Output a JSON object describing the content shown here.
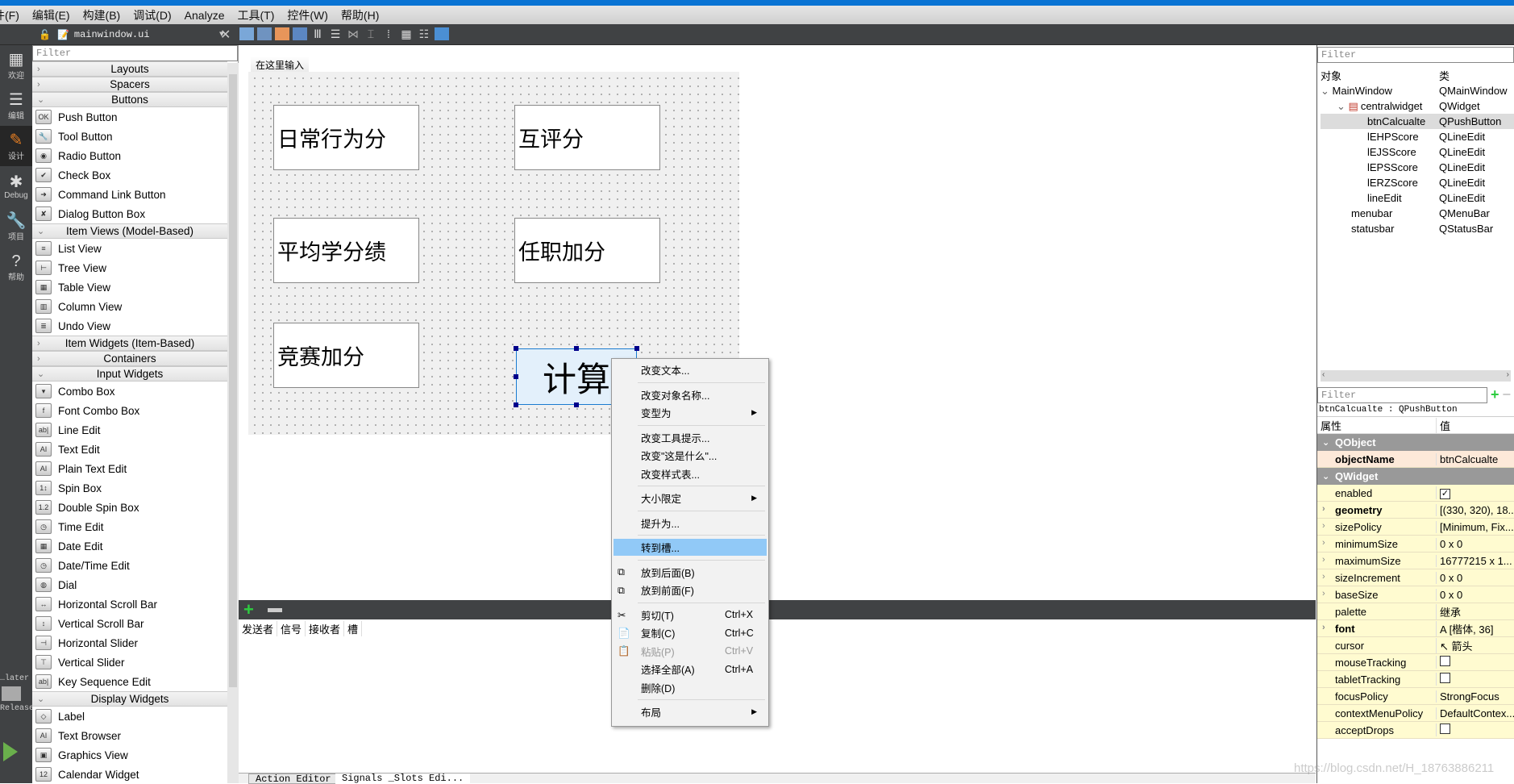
{
  "menubar": [
    "文件(F)",
    "编辑(E)",
    "构建(B)",
    "调试(D)",
    "Analyze",
    "工具(T)",
    "控件(W)",
    "帮助(H)"
  ],
  "toolbar": {
    "file_name": "mainwindow.ui"
  },
  "modebar": [
    {
      "label": "欢迎",
      "icon": "grid-icon"
    },
    {
      "label": "编辑",
      "icon": "edit-icon"
    },
    {
      "label": "设计",
      "icon": "pencil-icon",
      "active": true
    },
    {
      "label": "Debug",
      "icon": "bug-icon"
    },
    {
      "label": "项目",
      "icon": "wrench-icon"
    },
    {
      "label": "帮助",
      "icon": "help-icon"
    }
  ],
  "modebar_bottom": {
    "kit_label": "…later",
    "build_label": "Release"
  },
  "widgetbox": {
    "filter_placeholder": "Filter",
    "sections": [
      {
        "name": "Layouts",
        "expanded": false,
        "items": []
      },
      {
        "name": "Spacers",
        "expanded": false,
        "items": []
      },
      {
        "name": "Buttons",
        "expanded": true,
        "items": [
          {
            "label": "Push Button",
            "glyph": "OK"
          },
          {
            "label": "Tool Button",
            "glyph": "🔧"
          },
          {
            "label": "Radio Button",
            "glyph": "◉"
          },
          {
            "label": "Check Box",
            "glyph": "✔"
          },
          {
            "label": "Command Link Button",
            "glyph": "➜"
          },
          {
            "label": "Dialog Button Box",
            "glyph": "✘"
          }
        ]
      },
      {
        "name": "Item Views (Model-Based)",
        "expanded": true,
        "items": [
          {
            "label": "List View",
            "glyph": "≡"
          },
          {
            "label": "Tree View",
            "glyph": "⊢"
          },
          {
            "label": "Table View",
            "glyph": "▦"
          },
          {
            "label": "Column View",
            "glyph": "▥"
          },
          {
            "label": "Undo View",
            "glyph": "≣"
          }
        ]
      },
      {
        "name": "Item Widgets (Item-Based)",
        "expanded": false,
        "items": []
      },
      {
        "name": "Containers",
        "expanded": false,
        "items": []
      },
      {
        "name": "Input Widgets",
        "expanded": true,
        "items": [
          {
            "label": "Combo Box",
            "glyph": "▾"
          },
          {
            "label": "Font Combo Box",
            "glyph": "f"
          },
          {
            "label": "Line Edit",
            "glyph": "ab|"
          },
          {
            "label": "Text Edit",
            "glyph": "AI"
          },
          {
            "label": "Plain Text Edit",
            "glyph": "AI"
          },
          {
            "label": "Spin Box",
            "glyph": "1↕"
          },
          {
            "label": "Double Spin Box",
            "glyph": "1.2"
          },
          {
            "label": "Time Edit",
            "glyph": "◷"
          },
          {
            "label": "Date Edit",
            "glyph": "▦"
          },
          {
            "label": "Date/Time Edit",
            "glyph": "◷"
          },
          {
            "label": "Dial",
            "glyph": "◍"
          },
          {
            "label": "Horizontal Scroll Bar",
            "glyph": "↔"
          },
          {
            "label": "Vertical Scroll Bar",
            "glyph": "↕"
          },
          {
            "label": "Horizontal Slider",
            "glyph": "⊣"
          },
          {
            "label": "Vertical Slider",
            "glyph": "⊤"
          },
          {
            "label": "Key Sequence Edit",
            "glyph": "ab|"
          }
        ]
      },
      {
        "name": "Display Widgets",
        "expanded": true,
        "items": [
          {
            "label": "Label",
            "glyph": "◇"
          },
          {
            "label": "Text Browser",
            "glyph": "AI"
          },
          {
            "label": "Graphics View",
            "glyph": "▣"
          },
          {
            "label": "Calendar Widget",
            "glyph": "12"
          }
        ]
      }
    ]
  },
  "form": {
    "menu_placeholder": "在这里输入",
    "line_edits": [
      "日常行为分",
      "互评分",
      "平均学分绩",
      "任职加分",
      "竞赛加分"
    ],
    "button_text": "计算"
  },
  "signal_editor": {
    "columns": [
      "发送者",
      "信号",
      "接收者",
      "槽"
    ],
    "tabs": [
      "Action Editor",
      "Signals _Slots Edi..."
    ]
  },
  "context_menu": {
    "items": [
      {
        "label": "改变文本..."
      },
      {
        "sep": true
      },
      {
        "label": "改变对象名称..."
      },
      {
        "label": "变型为",
        "submenu": true
      },
      {
        "sep": true
      },
      {
        "label": "改变工具提示..."
      },
      {
        "label": "改变\"这是什么\"..."
      },
      {
        "label": "改变样式表..."
      },
      {
        "sep": true
      },
      {
        "label": "大小限定",
        "submenu": true
      },
      {
        "sep": true
      },
      {
        "label": "提升为..."
      },
      {
        "sep": true
      },
      {
        "label": "转到槽...",
        "highlighted": true
      },
      {
        "sep": true
      },
      {
        "label": "放到后面(B)",
        "icon": "send-back-icon"
      },
      {
        "label": "放到前面(F)",
        "icon": "bring-front-icon"
      },
      {
        "sep": true
      },
      {
        "label": "剪切(T)",
        "shortcut": "Ctrl+X",
        "icon": "scissors-icon"
      },
      {
        "label": "复制(C)",
        "shortcut": "Ctrl+C",
        "icon": "copy-icon"
      },
      {
        "label": "粘贴(P)",
        "shortcut": "Ctrl+V",
        "icon": "paste-icon",
        "disabled": true
      },
      {
        "label": "选择全部(A)",
        "shortcut": "Ctrl+A"
      },
      {
        "label": "删除(D)"
      },
      {
        "sep": true
      },
      {
        "label": "布局",
        "submenu": true
      }
    ]
  },
  "object_inspector": {
    "filter_placeholder": "Filter",
    "headers": [
      "对象",
      "类"
    ],
    "rows": [
      {
        "name": "MainWindow",
        "class": "QMainWindow",
        "level": 0,
        "expander": "⌄"
      },
      {
        "name": "centralwidget",
        "class": "QWidget",
        "level": 1,
        "expander": "⌄",
        "icon": true
      },
      {
        "name": "btnCalcualte",
        "class": "QPushButton",
        "level": 2,
        "selected": true
      },
      {
        "name": "lEHPScore",
        "class": "QLineEdit",
        "level": 2
      },
      {
        "name": "lEJSScore",
        "class": "QLineEdit",
        "level": 2
      },
      {
        "name": "lEPSScore",
        "class": "QLineEdit",
        "level": 2
      },
      {
        "name": "lERZScore",
        "class": "QLineEdit",
        "level": 2
      },
      {
        "name": "lineEdit",
        "class": "QLineEdit",
        "level": 2
      },
      {
        "name": "menubar",
        "class": "QMenuBar",
        "level": 1
      },
      {
        "name": "statusbar",
        "class": "QStatusBar",
        "level": 1
      }
    ]
  },
  "property_editor": {
    "filter_placeholder": "Filter",
    "object_label": "btnCalcualte : QPushButton",
    "headers": [
      "属性",
      "值"
    ],
    "rows": [
      {
        "group": "QObject"
      },
      {
        "key": "objectName",
        "value": "btnCalcualte",
        "bold": true,
        "highlight": "#fde9d9"
      },
      {
        "group": "QWidget"
      },
      {
        "key": "enabled",
        "check": true
      },
      {
        "key": "geometry",
        "value": "[(330, 320), 18...",
        "bold": true,
        "expand": true
      },
      {
        "key": "sizePolicy",
        "value": "[Minimum, Fix...",
        "expand": true
      },
      {
        "key": "minimumSize",
        "value": "0 x 0",
        "expand": true
      },
      {
        "key": "maximumSize",
        "value": "16777215 x 1...",
        "expand": true
      },
      {
        "key": "sizeIncrement",
        "value": "0 x 0",
        "expand": true
      },
      {
        "key": "baseSize",
        "value": "0 x 0",
        "expand": true
      },
      {
        "key": "palette",
        "value": "继承"
      },
      {
        "key": "font",
        "value": "A  [楷体, 36]",
        "bold": true,
        "expand": true
      },
      {
        "key": "cursor",
        "value": "↖ 箭头"
      },
      {
        "key": "mouseTracking",
        "check": false
      },
      {
        "key": "tabletTracking",
        "check": false
      },
      {
        "key": "focusPolicy",
        "value": "StrongFocus"
      },
      {
        "key": "contextMenuPolicy",
        "value": "DefaultContex..."
      },
      {
        "key": "acceptDrops",
        "check": false
      }
    ]
  },
  "watermark": "https://blog.csdn.net/H_18763886211"
}
